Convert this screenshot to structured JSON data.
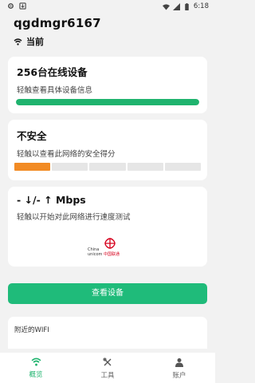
{
  "status_bar": {
    "time": "6:18"
  },
  "header": {
    "ssid": "qgdmgr6167",
    "current_label": "当前"
  },
  "devices_card": {
    "title": "256台在线设备",
    "subtitle": "轻触查看具体设备信息",
    "progress": 1.0
  },
  "security_card": {
    "title": "不安全",
    "subtitle": "轻触以查看此网络的安全得分",
    "segments_total": 5,
    "segments_active": 1
  },
  "speed_card": {
    "title": "- ↓/- ↑ Mbps",
    "subtitle": "轻触以开始对此网络进行速度测试",
    "provider_logo_text": "China unicom中国联通"
  },
  "view_devices_button": "查看设备",
  "nearby": {
    "title": "附近的WIFI"
  },
  "tabs": [
    {
      "label": "概览",
      "icon": "wifi-icon",
      "active": true
    },
    {
      "label": "工具",
      "icon": "tools-icon",
      "active": false
    },
    {
      "label": "账户",
      "icon": "person-icon",
      "active": false
    }
  ],
  "colors": {
    "accent": "#1fb36e",
    "warning": "#f28b24"
  }
}
